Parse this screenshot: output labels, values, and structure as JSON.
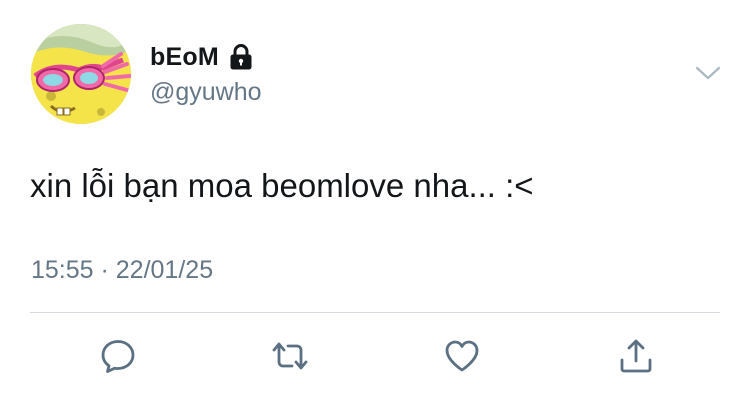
{
  "user": {
    "display_name": "bEoM",
    "handle": "@gyuwho",
    "avatar": "spongebob-with-pink-sunglasses",
    "protected_icon": "lock-icon"
  },
  "tweet": {
    "text": "xin lỗi bạn moa beomlove nha... :<",
    "timestamp": "15:55 · 22/01/25"
  },
  "actions": [
    {
      "name": "reply",
      "icon": "speech-bubble-icon"
    },
    {
      "name": "retweet",
      "icon": "retweet-arrows-icon"
    },
    {
      "name": "like",
      "icon": "heart-icon"
    },
    {
      "name": "share",
      "icon": "share-upload-icon"
    }
  ],
  "menu_icon": "chevron-down-icon",
  "colors": {
    "text_primary": "#14171a",
    "text_secondary": "#657786",
    "icon_gray": "#5b7083",
    "divider": "#d6dce0"
  }
}
